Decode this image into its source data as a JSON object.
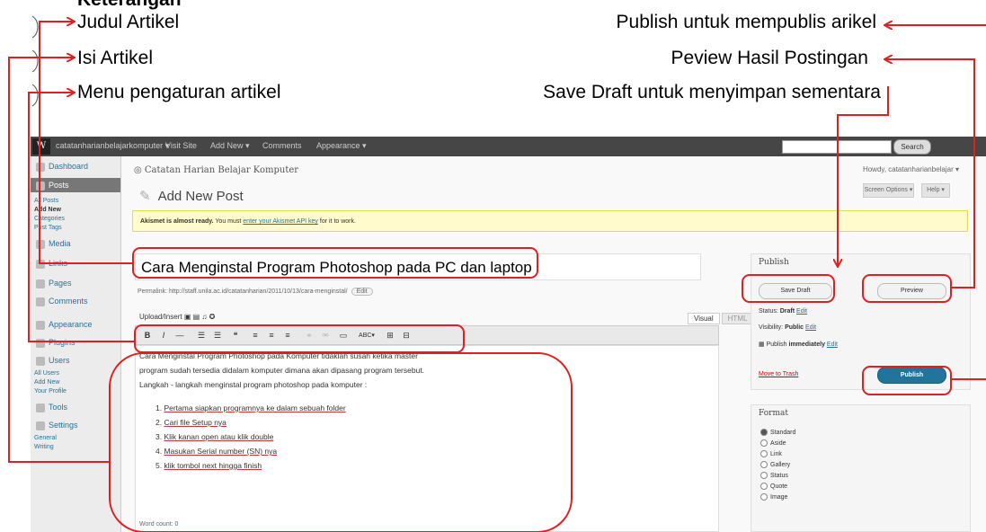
{
  "annotations": {
    "heading": "Keterangan",
    "left": [
      "Judul Artikel",
      "Isi Artikel",
      "Menu pengaturan artikel"
    ],
    "right": [
      "Publish untuk mempublis arikel",
      "Peview Hasil Postingan",
      "Save Draft untuk menyimpan sementara"
    ]
  },
  "admin_bar": {
    "logo": "W",
    "items": [
      "catatanharianbelajarkomputer ▾",
      "Visit Site",
      "Add New ▾",
      "Comments",
      "Appearance ▾"
    ],
    "search_button": "Search"
  },
  "sidebar": {
    "items": [
      {
        "label": "Dashboard"
      },
      {
        "label": "Posts",
        "active": true
      },
      {
        "label": "Media"
      },
      {
        "label": "Links"
      },
      {
        "label": "Pages"
      },
      {
        "label": "Comments"
      },
      {
        "label": "Appearance"
      },
      {
        "label": "Plugins"
      },
      {
        "label": "Users"
      },
      {
        "label": "Tools"
      },
      {
        "label": "Settings"
      }
    ],
    "post_sub": [
      "All Posts",
      "Add New",
      "Categories",
      "Post Tags"
    ],
    "users_sub": [
      "All Users",
      "Add New",
      "Your Profile"
    ],
    "settings_sub": [
      "General",
      "Writing"
    ]
  },
  "header": {
    "site_title": "Catatan Harian Belajar Komputer",
    "howdy": "Howdy, catatanharianbelajar ▾",
    "page_title": "Add New Post",
    "screen_options": "Screen Options ▾",
    "help": "Help ▾"
  },
  "notice": {
    "bold": "Akismet is almost ready.",
    "text": " You must ",
    "link": "enter your Akismet API key",
    "end": " for it to work."
  },
  "editor": {
    "title": "Cara Menginstal Program Photoshop pada PC dan laptop",
    "permalink": "Permalink: http://staff.unila.ac.id/catatanharian/2011/10/13/cara-menginstal/",
    "permalink_edit": "Edit",
    "upload_insert": "Upload/Insert",
    "tab_visual": "Visual",
    "tab_html": "HTML",
    "toolbar": [
      "B",
      "I",
      "—",
      "☰",
      "☰",
      "❝",
      "≡",
      "≡",
      "≡",
      "⚭",
      "⚮",
      "▭",
      "ABC▾",
      "⊞",
      "⊟"
    ],
    "paragraph1": "Cara Menginstal Program Photoshop pada Komputer tidaklah susah ketika master",
    "paragraph2": "program sudah tersedia didalam komputer dimana akan dipasang program tersebut.",
    "paragraph3": "Langkah - langkah menginstal program photoshop pada komputer :",
    "steps": [
      "Pertama siapkan programnya ke dalam sebuah folder",
      "Cari file Setup nya",
      "Klik kanan open atau klik double",
      "Masukan Serial number (SN) nya",
      "klik tombol next hingga finish"
    ],
    "status": "Word count: 0"
  },
  "publish_box": {
    "heading": "Publish",
    "save_draft": "Save Draft",
    "preview": "Preview",
    "status_label": "Status:",
    "status_value": "Draft",
    "visibility_label": "Visibility:",
    "visibility_value": "Public",
    "publish_label": "Publish",
    "publish_value": "immediately",
    "edit": "Edit",
    "trash": "Move to Trash",
    "publish_button": "Publish"
  },
  "format_box": {
    "heading": "Format",
    "options": [
      "Standard",
      "Aside",
      "Link",
      "Gallery",
      "Status",
      "Quote",
      "Image"
    ],
    "selected": "Standard"
  }
}
